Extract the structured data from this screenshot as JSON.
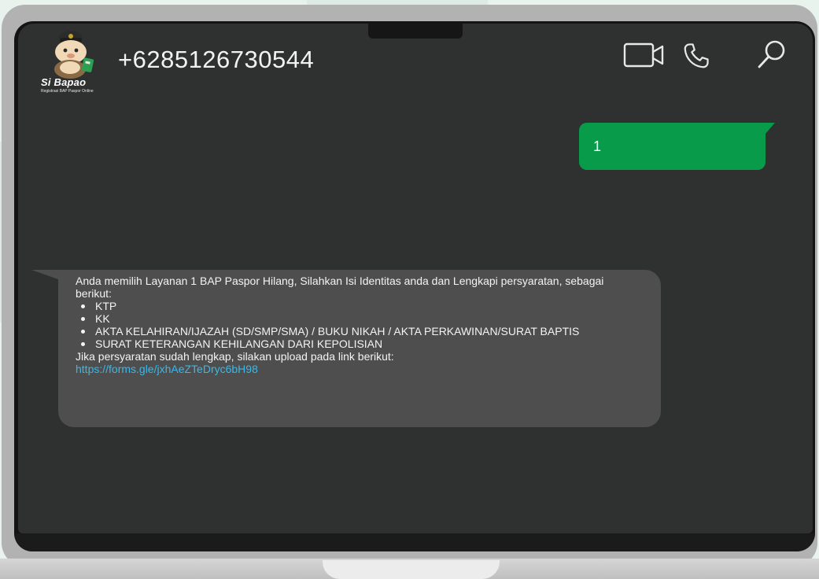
{
  "app": {
    "logo_title": "Si Bapao",
    "logo_subtitle": "Registrasi BAP Paspor Online"
  },
  "header": {
    "contact": "+6285126730544",
    "icons": [
      "video-call-icon",
      "voice-call-icon",
      "search-icon"
    ]
  },
  "messages": {
    "sent": {
      "text": "1"
    },
    "received": {
      "intro": "Anda memilih Layanan 1 BAP Paspor Hilang, Silahkan Isi Identitas anda dan Lengkapi persyaratan, sebagai berikut:",
      "requirements": [
        "KTP",
        "KK",
        "AKTA KELAHIRAN/IJAZAH (SD/SMP/SMA) / BUKU NIKAH / AKTA PERKAWINAN/SURAT BAPTIS",
        "SURAT KETERANGAN KEHILANGAN DARI KEPOLISIAN"
      ],
      "outro": "Jika persyaratan sudah lengkap, silakan upload pada link berikut:",
      "link": "https://forms.gle/jxhAeZTeDryc6bH98"
    }
  },
  "colors": {
    "sent_bubble": "#079b4a",
    "received_bubble": "#4e4e4e",
    "link": "#39b9ea",
    "screen": "#2f3030"
  }
}
